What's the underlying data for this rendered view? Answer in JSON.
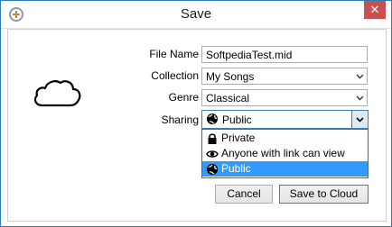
{
  "window": {
    "title": "Save",
    "close_glyph": "✕"
  },
  "form": {
    "file_name_label": "File Name",
    "file_name_value": "SoftpediaTest.mid",
    "collection_label": "Collection",
    "collection_value": "My Songs",
    "genre_label": "Genre",
    "genre_value": "Classical",
    "sharing_label": "Sharing",
    "sharing_value": "Public",
    "sharing_options": [
      {
        "label": "Private",
        "icon": "lock-icon"
      },
      {
        "label": "Anyone with link can view",
        "icon": "eye-icon"
      },
      {
        "label": "Public",
        "icon": "globe-icon",
        "selected": true
      }
    ]
  },
  "buttons": {
    "cancel": "Cancel",
    "save": "Save to Cloud"
  },
  "colors": {
    "accent": "#3399ff",
    "close_bg": "#c75050",
    "focus_border": "#3c7fb1"
  }
}
